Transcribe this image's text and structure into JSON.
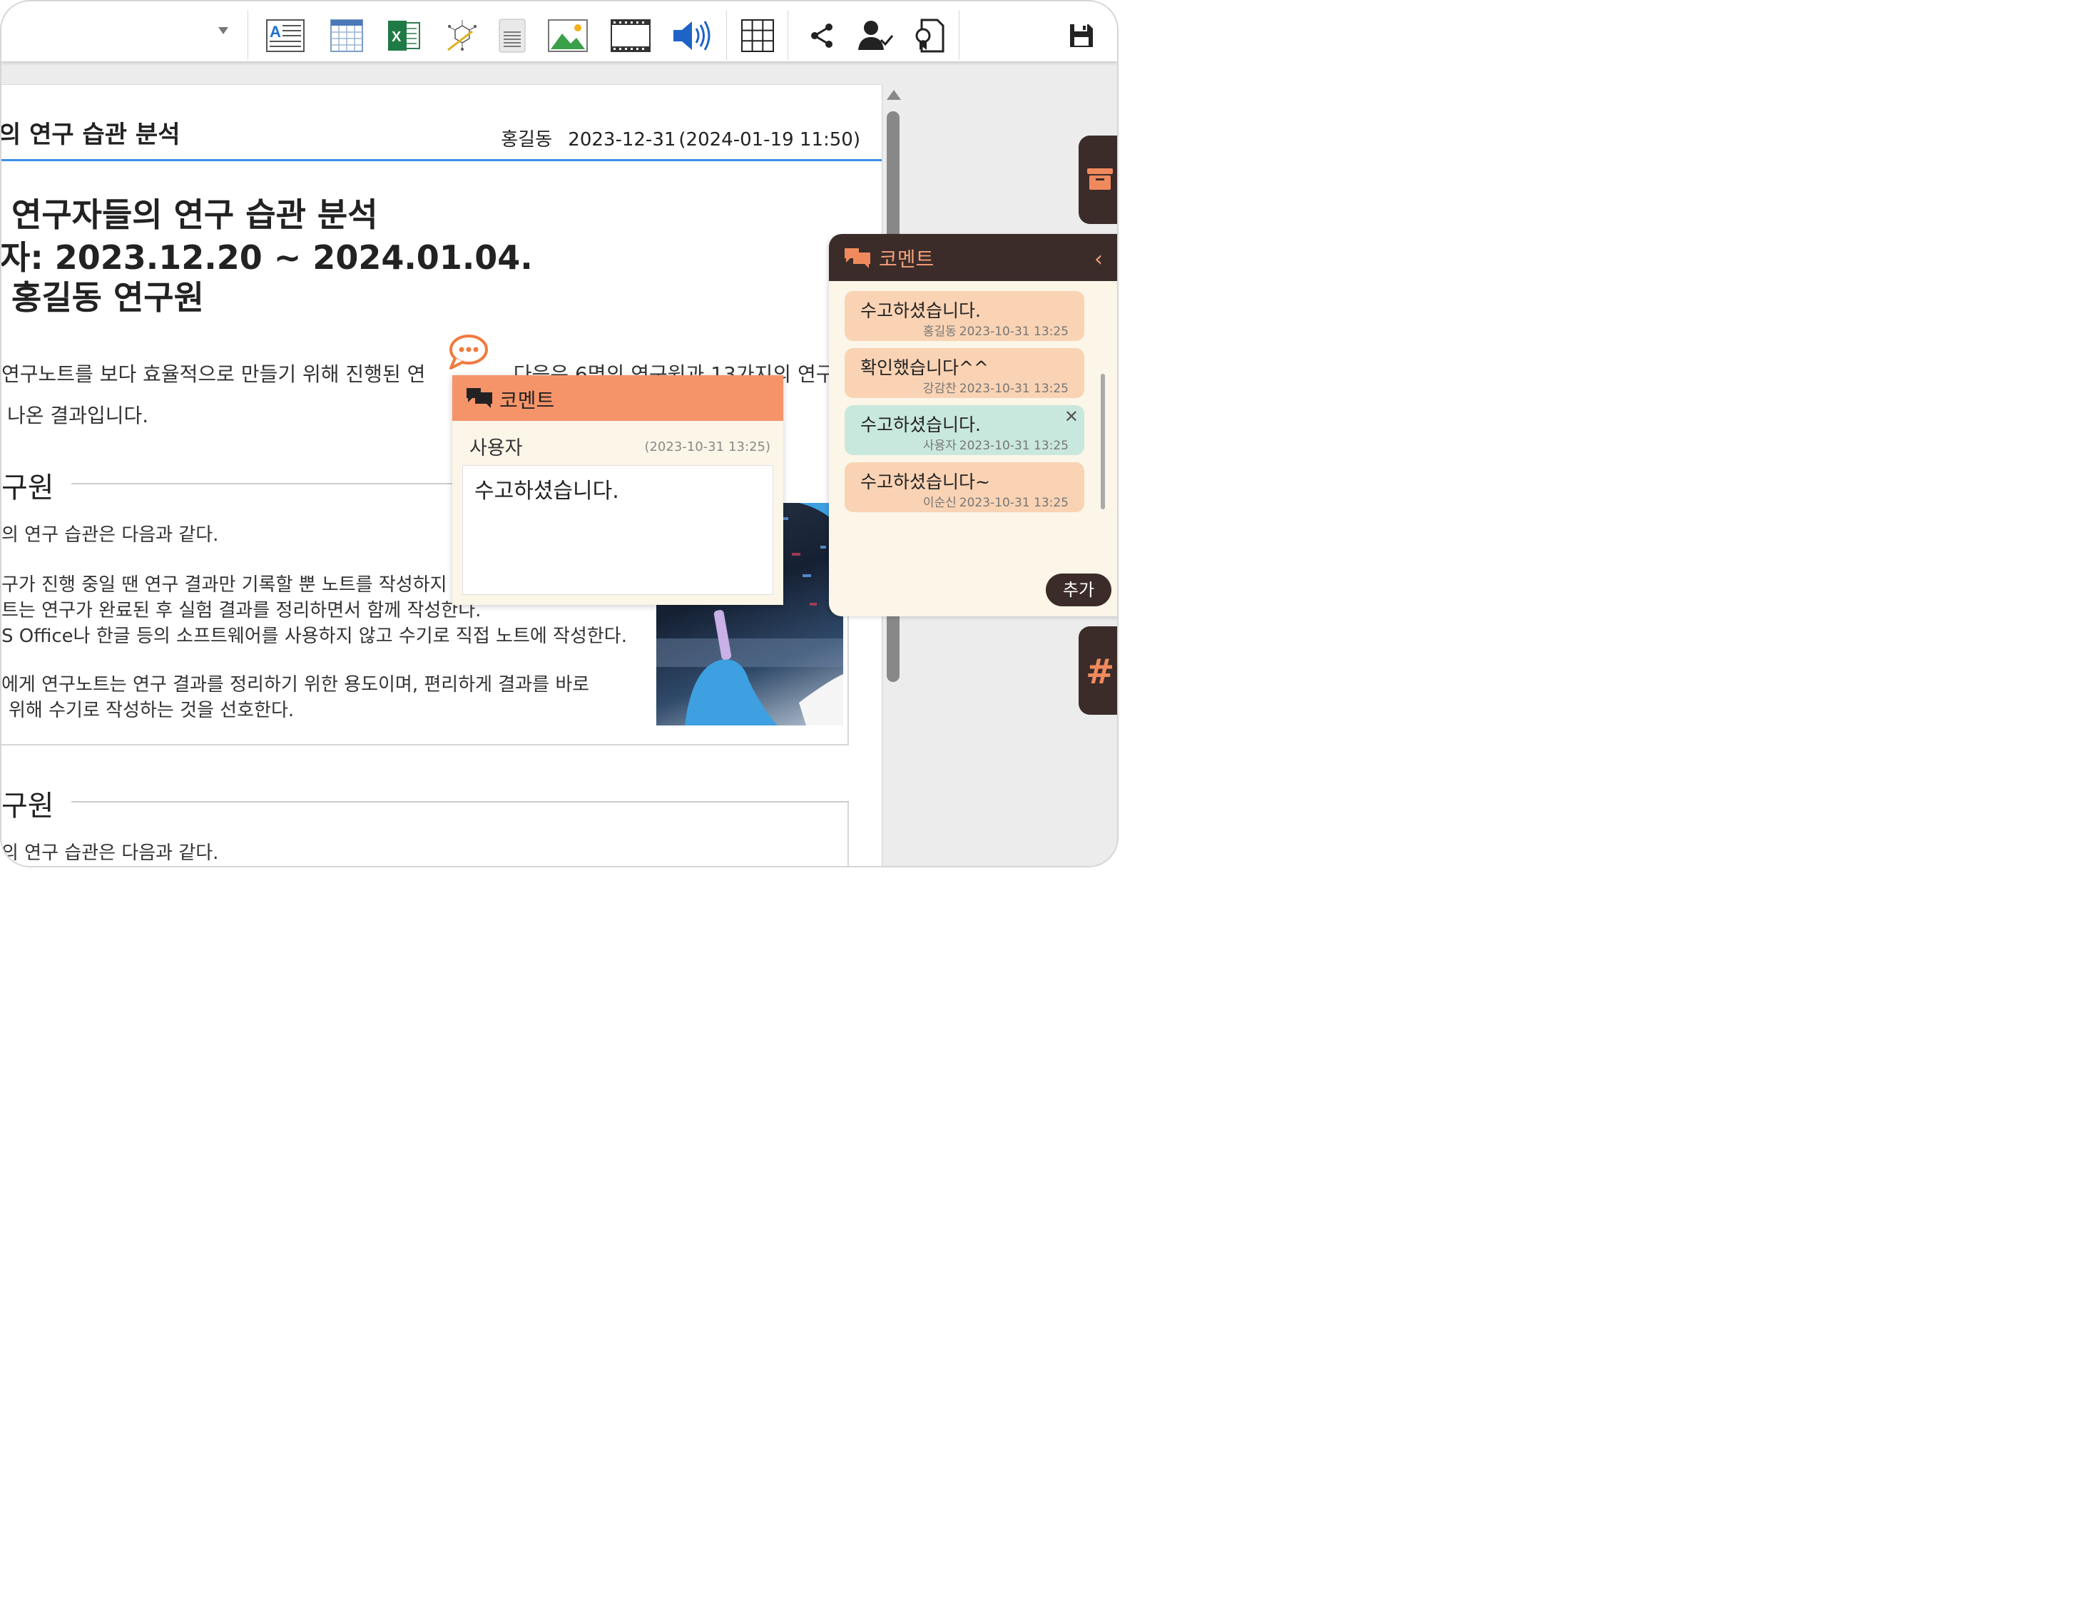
{
  "toolbar": {
    "tools": [
      "text-icon",
      "table-icon",
      "excel-icon",
      "chemical-structure-icon",
      "document-icon",
      "image-icon",
      "video-icon",
      "audio-icon",
      "grid-icon",
      "share-icon",
      "user-check-icon",
      "certificate-icon",
      "save-icon"
    ]
  },
  "doc": {
    "header_title": "의 연구 습관 분석",
    "author": "홍길동",
    "date": "2023-12-31",
    "modified": "(2024-01-19 11:50)",
    "big_line1": "연구자들의 연구 습관 분석",
    "big_line2": "자: 2023.12.20 ~ 2024.01.04.",
    "big_line3": "홍길동 연구원",
    "para1a": "연구노트를 보다 효율적으로 만들기 위해 진행된 연",
    "para1b": ". 다음은 6명의 연구원과 13가지의 연구",
    "para2": "나온 결과입니다.",
    "section1_title": "구원",
    "section1_intro": "의 연구 습관은 다음과 같다.",
    "section1_line1": "구가 진행 중일 땐 연구 결과만 기록할 뿐 노트를 작성하지",
    "section1_line2": "트는 연구가 완료된 후 실험 결과를 정리하면서 함께 작성한다.",
    "section1_line3": "S Office나 한글 등의 소프트웨어를 사용하지 않고 수기로 직접 노트에 작성한다.",
    "section1_line4": "에게 연구노트는 연구 결과를 정리하기 위한 용도이며, 편리하게 결과를 바로",
    "section1_line5": "위해 수기로 작성하는 것을 선호한다.",
    "section2_title": "구원",
    "section2_intro": "의 연구 습관은 다음과 같다."
  },
  "comments_panel": {
    "title": "코멘트",
    "add_label": "추가",
    "items": [
      {
        "text": "수고하셨습니다.",
        "author": "홍길동",
        "date": "2023-10-31  13:25",
        "mine": false
      },
      {
        "text": "확인했습니다^^",
        "author": "강감찬",
        "date": "2023-10-31  13:25",
        "mine": false
      },
      {
        "text": "수고하셨습니다.",
        "author": "사용자",
        "date": "2023-10-31  13:25",
        "mine": true
      },
      {
        "text": "수고하셨습니다~",
        "author": "이순신",
        "date": "2023-10-31  13:25",
        "mine": false
      }
    ]
  },
  "popup": {
    "title": "코멘트",
    "user": "사용자",
    "date": "(2023-10-31",
    "time": "13:25)",
    "text": "수고하셨습니다."
  },
  "side": {
    "hash_label": "#"
  },
  "colors": {
    "accent": "#f69469",
    "dark": "#3b2c2a",
    "blue": "#3b8ee8",
    "mine": "#c9e8dd",
    "other": "#f9d3b4"
  }
}
